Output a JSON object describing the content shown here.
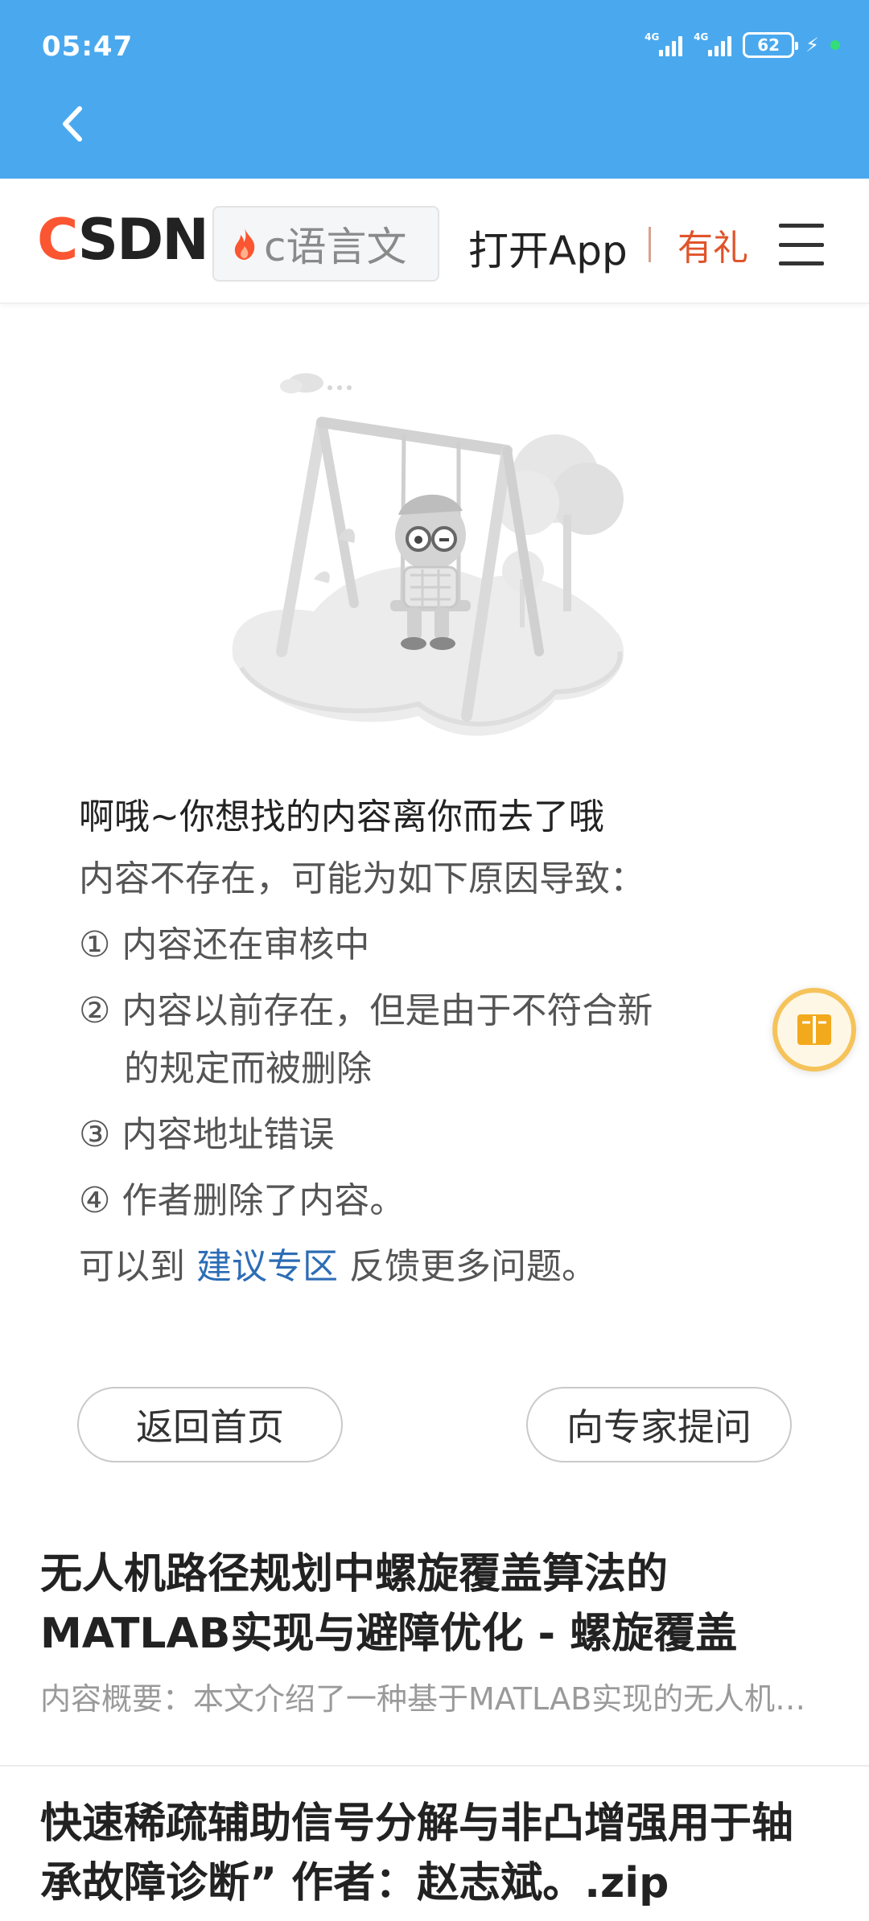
{
  "status_bar": {
    "time": "05:47",
    "signal_tag_1": "4G",
    "signal_tag_2": "4G",
    "battery": "62"
  },
  "header": {
    "logo_c": "C",
    "logo_rest": "SDN",
    "search_chip": "c语言文",
    "open_app": "打开App",
    "gift": "有礼"
  },
  "message": {
    "title": "啊哦~你想找的内容离你而去了哦",
    "intro": "内容不存在，可能为如下原因导致：",
    "reason1": "① 内容还在审核中",
    "reason2_a": "② 内容以前存在，但是由于不符合新",
    "reason2_b": "的规定而被删除",
    "reason3": "③ 内容地址错误",
    "reason4": "④ 作者删除了内容。",
    "feedback_prefix": "可以到 ",
    "feedback_link": "建议专区",
    "feedback_suffix": " 反馈更多问题。"
  },
  "buttons": {
    "home": "返回首页",
    "ask": "向专家提问"
  },
  "articles": [
    {
      "title": "无人机路径规划中螺旋覆盖算法的MATLAB实现与避障优化 - 螺旋覆盖",
      "desc": "内容概要：本文介绍了一种基于MATLAB实现的无人机路径规划螺旋覆盖算法"
    },
    {
      "title": "快速稀疏辅助信号分解与非凸增强用于轴承故障诊断” 作者：赵志斌。.zip"
    }
  ],
  "colors": {
    "status_bar_bg": "#4aa9ee",
    "brand_red": "#fc5531",
    "link_blue": "#2d6db5",
    "gift_orange": "#e0542b"
  },
  "icons": [
    "back-arrow-icon",
    "flame-icon",
    "menu-icon",
    "book-icon"
  ]
}
